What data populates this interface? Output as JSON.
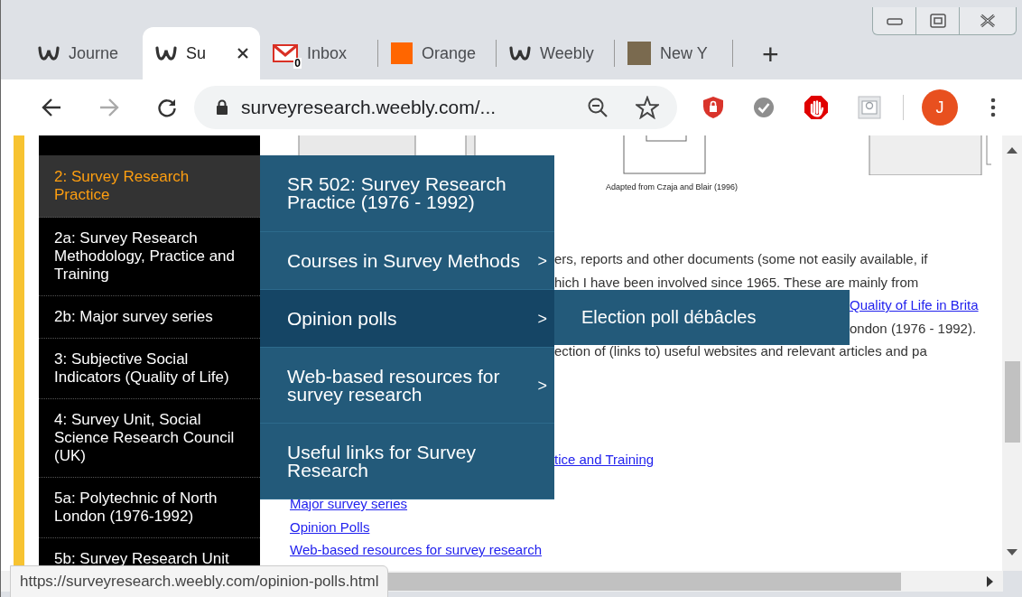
{
  "tabs": [
    {
      "title": "Journe",
      "kind": "weebly",
      "selected": false
    },
    {
      "title": "Su",
      "kind": "weebly",
      "selected": true
    },
    {
      "title": "Inbox",
      "kind": "mail",
      "badge": "0",
      "selected": false
    },
    {
      "title": "Orange",
      "kind": "square",
      "selected": false
    },
    {
      "title": "Weebly",
      "kind": "weebly",
      "selected": false
    },
    {
      "title": "New Y",
      "kind": "photo",
      "selected": false
    }
  ],
  "new_tab": "+",
  "toolbar": {
    "url": "surveyresearch.weebly.com/...",
    "forward_disabled": true,
    "avatar": "J"
  },
  "sidebar": {
    "items": [
      {
        "label": "2: Survey Research Practice",
        "selected": true
      },
      {
        "label": "2a: Survey Research Methodology, Practice and Training",
        "selected": false
      },
      {
        "label": "2b: Major survey series",
        "selected": false
      },
      {
        "label": "3: Subjective Social Indicators (Quality of Life)",
        "selected": false
      },
      {
        "label": "4: Survey Unit, Social Science Research Council (UK)",
        "selected": false
      },
      {
        "label": "5a: Polytechnic of North London (1976-1992)",
        "selected": false
      },
      {
        "label": "5b: Survey Research Unit",
        "selected": false
      }
    ]
  },
  "menu": {
    "items": [
      {
        "label": "SR 502: Survey Research Practice (1976 - 1992)",
        "selected": false
      },
      {
        "label": "Courses in Survey Methods",
        "arrow": ">",
        "selected": false
      },
      {
        "label": "Opinion polls",
        "arrow": ">",
        "selected": true,
        "children": [
          {
            "label": "Election poll débâcles"
          }
        ]
      },
      {
        "label": "Web-based resources for survey research",
        "arrow": ">",
        "selected": false
      },
      {
        "label": "Useful links for Survey Research",
        "selected": false
      }
    ]
  },
  "content": {
    "caption": "Adapted from Czaja and Blair (1996)",
    "lines": [
      {
        "text": "ers, reports and other documents (some not easily available, if",
        "kind": "text"
      },
      {
        "text": "hich I have been involved since 1965.  These are mainly from",
        "kind": "text"
      },
      {
        "text": "Quality of Life in Brita",
        "kind": "link"
      },
      {
        "text": "ondon (1976 - 1992).",
        "kind": "text"
      },
      {
        "text": "ection of (links to) useful websites and relevant articles and pa",
        "kind": "text"
      }
    ],
    "links": [
      {
        "text": "tice and Training"
      },
      {
        "text": "Major survey series"
      },
      {
        "text": "Opinion Polls"
      },
      {
        "text": "Web-based resources for survey research "
      }
    ]
  },
  "status_bar": {
    "url": "https://surveyresearch.weebly.com/opinion-polls.html"
  }
}
